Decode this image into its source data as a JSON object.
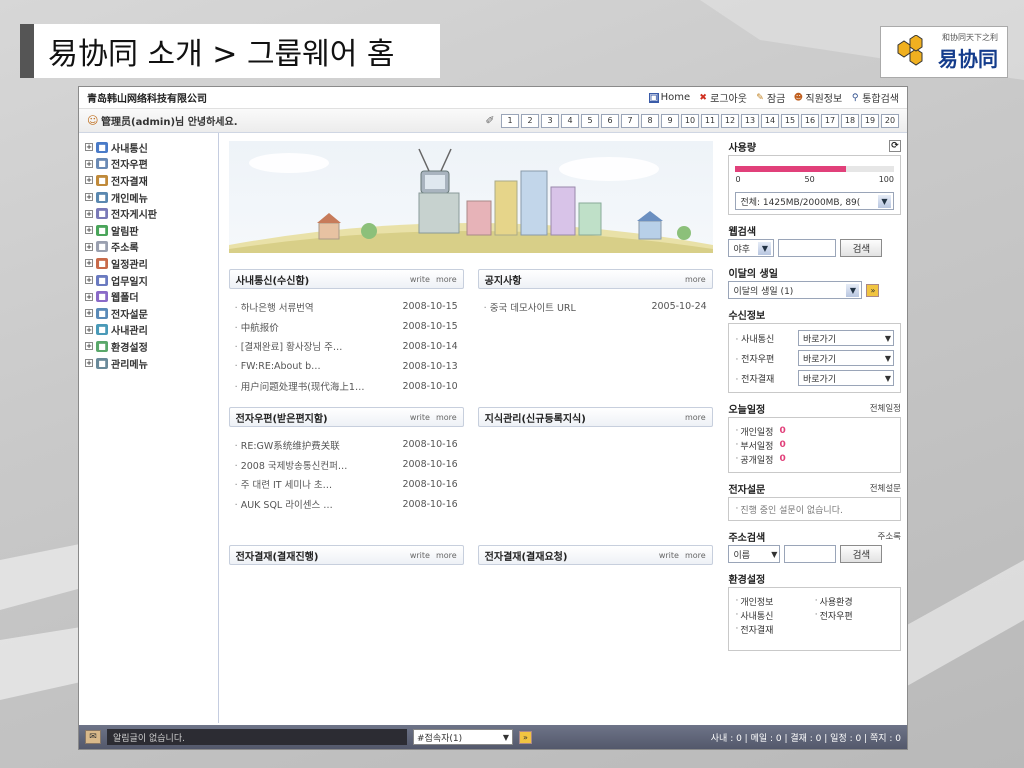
{
  "slide": {
    "title": "易协同 소개 > 그룹웨어 홈",
    "logo_small": "和协同天下之利",
    "logo_big": "易协同"
  },
  "app": {
    "company": "青岛韩山网络科技有限公司",
    "topnav": [
      {
        "label": "Home",
        "icon": "home-icon"
      },
      {
        "label": "로그아웃",
        "icon": "logout-x-icon"
      },
      {
        "label": "잠금",
        "icon": "lock-icon"
      },
      {
        "label": "직원정보",
        "icon": "employee-info-icon"
      },
      {
        "label": "통합검색",
        "icon": "search-icon"
      }
    ],
    "greeting": "管理员(admin)님 안녕하세요.",
    "pages": [
      "1",
      "2",
      "3",
      "4",
      "5",
      "6",
      "7",
      "8",
      "9",
      "10",
      "11",
      "12",
      "13",
      "14",
      "15",
      "16",
      "17",
      "18",
      "19",
      "20"
    ],
    "sidebar": [
      {
        "label": "사내통신",
        "color": "#4a7bc8"
      },
      {
        "label": "전자우편",
        "color": "#6a8ab5"
      },
      {
        "label": "전자결재",
        "color": "#c08a3a"
      },
      {
        "label": "개인메뉴",
        "color": "#5a88b0"
      },
      {
        "label": "전자게시판",
        "color": "#7a7ab8"
      },
      {
        "label": "알림판",
        "color": "#4aa55a"
      },
      {
        "label": "주소록",
        "color": "#9aa0b0"
      },
      {
        "label": "일정관리",
        "color": "#c86a4a"
      },
      {
        "label": "업무일지",
        "color": "#6a7ac0"
      },
      {
        "label": "웹폴더",
        "color": "#8a6ac8"
      },
      {
        "label": "전자설문",
        "color": "#5a8ab8"
      },
      {
        "label": "사내관리",
        "color": "#4a9ab8"
      },
      {
        "label": "환경설정",
        "color": "#5aa86a"
      },
      {
        "label": "관리메뉴",
        "color": "#6a8a9a"
      }
    ],
    "panels": [
      {
        "title": "사내통신(수신함)",
        "write": "write",
        "more": "more",
        "items": [
          {
            "t": "하나은행 서류번역",
            "d": "2008-10-15"
          },
          {
            "t": "中航报价",
            "d": "2008-10-15"
          },
          {
            "t": "[결재완료] 황사장님 주…",
            "d": "2008-10-14"
          },
          {
            "t": "FW:RE:About b…",
            "d": "2008-10-13"
          },
          {
            "t": "用户问题处理书(现代海上1…",
            "d": "2008-10-10"
          }
        ]
      },
      {
        "title": "공지사항",
        "write": "",
        "more": "more",
        "items": [
          {
            "t": "중국 데모사이트 URL",
            "d": "2005-10-24"
          }
        ]
      },
      {
        "title": "전자우편(받은편지함)",
        "write": "write",
        "more": "more",
        "items": [
          {
            "t": "RE:GW系统维护费关联",
            "d": "2008-10-16"
          },
          {
            "t": "2008 국제방송통신컨퍼…",
            "d": "2008-10-16"
          },
          {
            "t": "주 대련 IT 세미나 초…",
            "d": "2008-10-16"
          },
          {
            "t": "AUK SQL 라이센스 …",
            "d": "2008-10-16"
          }
        ]
      },
      {
        "title": "지식관리(신규등록지식)",
        "write": "",
        "more": "more",
        "items": []
      },
      {
        "title": "전자결재(결재진행)",
        "write": "write",
        "more": "more",
        "items": []
      },
      {
        "title": "전자결재(결재요청)",
        "write": "write",
        "more": "more",
        "items": []
      }
    ],
    "right": {
      "usage": {
        "title": "사용량",
        "scale": [
          "0",
          "50",
          "100"
        ],
        "percent": 70,
        "select": "전체: 1425MB/2000MB, 89("
      },
      "websearch": {
        "title": "웹검색",
        "select": "야후",
        "button": "검색"
      },
      "birthday": {
        "title": "이달의 생일",
        "select": "이달의 생일 (1)"
      },
      "receive": {
        "title": "수신정보",
        "rows": [
          {
            "label": "사내통신",
            "select": "바로가기"
          },
          {
            "label": "전자우편",
            "select": "바로가기"
          },
          {
            "label": "전자결재",
            "select": "바로가기"
          }
        ]
      },
      "today": {
        "title": "오늘일정",
        "more": "전체일정",
        "rows": [
          {
            "label": "개인일정",
            "count": "0"
          },
          {
            "label": "부서일정",
            "count": "0"
          },
          {
            "label": "공개일정",
            "count": "0"
          }
        ]
      },
      "survey": {
        "title": "전자설문",
        "more": "전체설문",
        "text": "진행 중인 설문이 없습니다."
      },
      "address": {
        "title": "주소검색",
        "more": "주소록",
        "select": "이름",
        "button": "검색"
      },
      "settings": {
        "title": "환경설정",
        "items": [
          "개인정보",
          "사용환경",
          "사내통신",
          "전자우편",
          "전자결재"
        ]
      }
    },
    "status": {
      "message": "알림글이 없습니다.",
      "select": "#접속자(1)",
      "counts": "사내 : 0 | 메일 : 0 | 결재 : 0 | 일정 : 0 | 쪽지 : 0"
    }
  },
  "colors": {
    "accent_pink": "#e1407a",
    "nav_blue": "#143c8c"
  }
}
